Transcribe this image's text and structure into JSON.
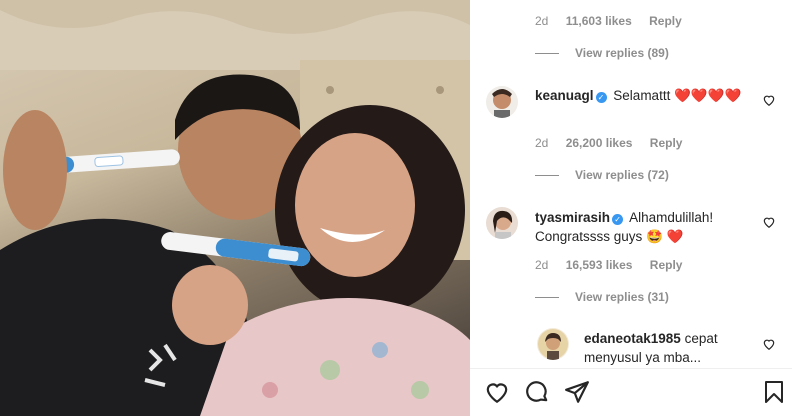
{
  "comments": [
    {
      "date": "2d",
      "likes": "11,603 likes",
      "reply": "Reply",
      "view_replies": "View replies (89)"
    },
    {
      "user": "keanuagl",
      "text": "Selamattt",
      "emoji": "❤️❤️❤️❤️",
      "date": "2d",
      "likes": "26,200 likes",
      "reply": "Reply",
      "view_replies": "View replies (72)"
    },
    {
      "user": "tyasmirasih",
      "text": "Alhamdulillah!",
      "text2": "Congratssss guys",
      "emoji": "🤩 ❤️",
      "date": "2d",
      "likes": "16,593 likes",
      "reply": "Reply",
      "view_replies": "View replies (31)"
    },
    {
      "user": "edaneotak1985",
      "text": "cepat",
      "text2": "menyusul ya mba..."
    }
  ],
  "icons": {
    "like": "heart-icon",
    "comment": "comment-icon",
    "share": "share-icon",
    "save": "bookmark-icon",
    "verified": "verified-badge-icon"
  },
  "colors": {
    "heart_red": "#ed4956",
    "verified_blue": "#3897f0",
    "muted": "#8e8e8e"
  }
}
